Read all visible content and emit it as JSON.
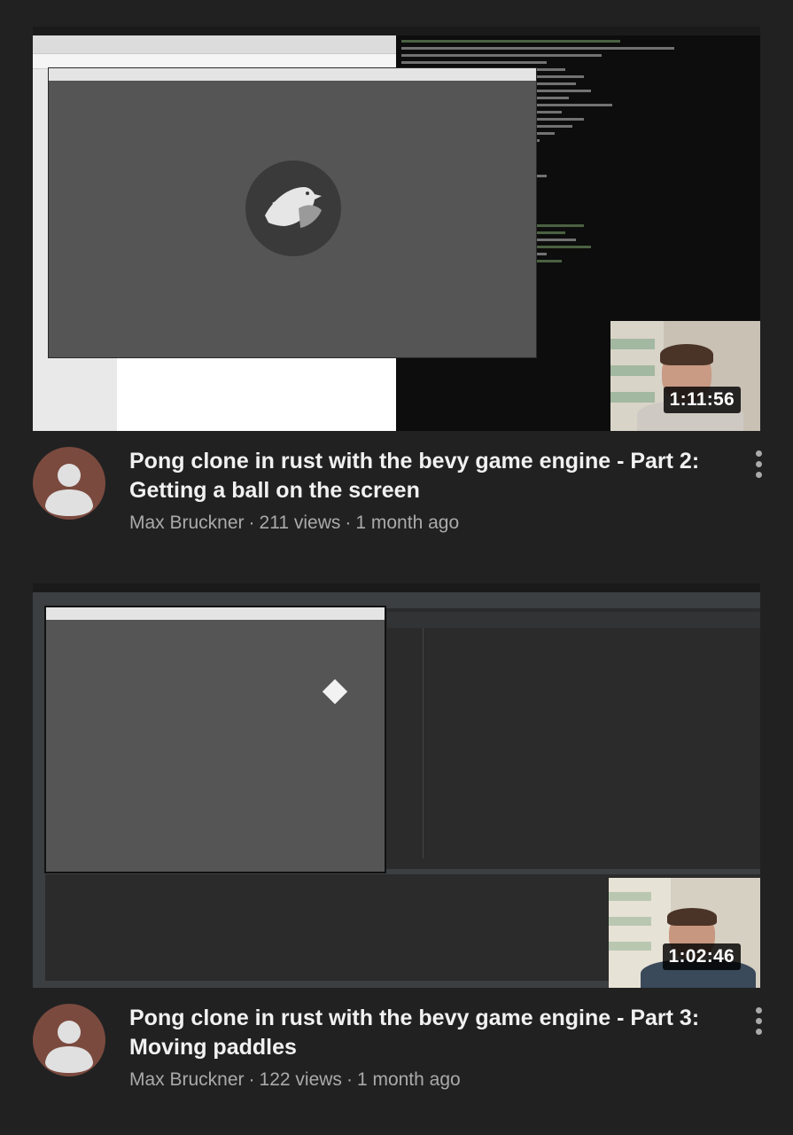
{
  "videos": [
    {
      "title": "Pong clone in rust with the bevy game engine - Part 2: Getting a ball on the screen",
      "duration": "1:11:56",
      "channel": "Max Bruckner",
      "views": "211 views",
      "age": "1 month ago",
      "separator": "·"
    },
    {
      "title": "Pong clone in rust with the bevy game engine - Part 3: Moving paddles",
      "duration": "1:02:46",
      "channel": "Max Bruckner",
      "views": "122 views",
      "age": "1 month ago",
      "separator": "·"
    }
  ],
  "colors": {
    "background": "#212121",
    "title": "#f1f1f1",
    "secondary_text": "#aaaaaa",
    "avatar_bg": "#7b4a3f",
    "avatar_fg": "#e0e0e0"
  },
  "icons": {
    "avatar": "default-person-icon",
    "menu": "more-vertical-icon"
  }
}
